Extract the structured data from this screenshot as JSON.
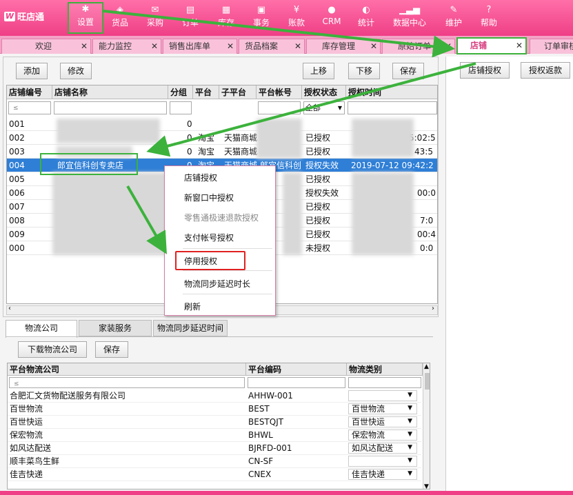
{
  "app": {
    "name": "旺店通",
    "logo_glyph": "W"
  },
  "nav": [
    {
      "label": "设置",
      "icon": "gear-icon",
      "glyph": "✱"
    },
    {
      "label": "货品",
      "icon": "box-icon",
      "glyph": "◈"
    },
    {
      "label": "采购",
      "icon": "mail-icon",
      "glyph": "✉"
    },
    {
      "label": "订单",
      "icon": "clipboard-icon",
      "glyph": "▤"
    },
    {
      "label": "库存",
      "icon": "grid-icon",
      "glyph": "▦"
    },
    {
      "label": "事务",
      "icon": "chat-icon",
      "glyph": "▣"
    },
    {
      "label": "账款",
      "icon": "yen-icon",
      "glyph": "¥"
    },
    {
      "label": "CRM",
      "icon": "user-icon",
      "glyph": "●"
    },
    {
      "label": "统计",
      "icon": "pie-icon",
      "glyph": "◐"
    },
    {
      "label": "数据中心",
      "icon": "bar-chart-icon",
      "glyph": "▁▃▅"
    },
    {
      "label": "维护",
      "icon": "wrench-icon",
      "glyph": "✎"
    },
    {
      "label": "帮助",
      "icon": "help-icon",
      "glyph": "?"
    }
  ],
  "tabs": [
    "欢迎",
    "能力监控",
    "销售出库单",
    "货品档案",
    "库存管理",
    "原始订单",
    "店铺",
    "订单审核"
  ],
  "toolbar": {
    "add": "添加",
    "edit": "修改",
    "up": "上移",
    "down": "下移",
    "save": "保存"
  },
  "grid": {
    "headers": [
      "店铺编号",
      "店铺名称",
      "分组",
      "平台",
      "子平台",
      "平台帐号",
      "授权状态",
      "授权时间"
    ],
    "filter_status": "全部",
    "rows": [
      {
        "id": "001",
        "name": "",
        "group": "0",
        "platform": "",
        "sub": "",
        "account": "",
        "status": "",
        "time": ""
      },
      {
        "id": "002",
        "name": "",
        "group": "0",
        "platform": "淘宝",
        "sub": "天猫商城",
        "account": "",
        "status": "已授权",
        "time": "5:02:5"
      },
      {
        "id": "003",
        "name": "",
        "group": "0",
        "platform": "淘宝",
        "sub": "天猫商城",
        "account": "",
        "status": "已授权",
        "time": "43:5"
      },
      {
        "id": "004",
        "name": "郎宜信科创专卖店",
        "group": "0",
        "platform": "淘宝",
        "sub": "天猫商城",
        "account": "郎宜信科创",
        "status": "授权失效",
        "time": "2019-07-12 09:42:2"
      },
      {
        "id": "005",
        "name": "",
        "group": "",
        "platform": "",
        "sub": "",
        "account": "",
        "status": "已授权",
        "time": ""
      },
      {
        "id": "006",
        "name": "",
        "group": "",
        "platform": "",
        "sub": "",
        "account": "",
        "status": "授权失效",
        "time": "00:0"
      },
      {
        "id": "007",
        "name": "",
        "group": "",
        "platform": "",
        "sub": "",
        "account": "",
        "status": "已授权",
        "time": ""
      },
      {
        "id": "008",
        "name": "",
        "group": "",
        "platform": "",
        "sub": "",
        "account": "",
        "status": "已授权",
        "time": "7:0"
      },
      {
        "id": "009",
        "name": "",
        "group": "",
        "platform": "",
        "sub": "",
        "account": "",
        "status": "已授权",
        "time": "00:4"
      },
      {
        "id": "000",
        "name": "",
        "group": "",
        "platform": "",
        "sub": "",
        "account": "",
        "status": "未授权",
        "time": "0:0"
      }
    ]
  },
  "context_menu": [
    "店铺授权",
    "新窗口中授权",
    "零售通极速退款授权",
    "支付帐号授权",
    "停用授权",
    "物流同步延迟时长",
    "刷新"
  ],
  "right_buttons": {
    "shop_auth": "店铺授权",
    "refund_auth": "授权返款"
  },
  "bottom": {
    "tabs": [
      "物流公司",
      "家装服务",
      "物流同步延迟时间"
    ],
    "download": "下载物流公司",
    "save": "保存",
    "headers": [
      "平台物流公司",
      "平台编码",
      "物流类别"
    ],
    "rows": [
      {
        "name": "合肥汇文货物配送服务有限公司",
        "code": "AHHW-001",
        "type": ""
      },
      {
        "name": "百世物流",
        "code": "BEST",
        "type": "百世物流"
      },
      {
        "name": "百世快运",
        "code": "BESTQJT",
        "type": "百世快运"
      },
      {
        "name": "保宏物流",
        "code": "BHWL",
        "type": "保宏物流"
      },
      {
        "name": "如风达配送",
        "code": "BJRFD-001",
        "type": "如风达配送"
      },
      {
        "name": "顺丰菜鸟生鲜",
        "code": "CN-SF",
        "type": ""
      },
      {
        "name": "佳吉快递",
        "code": "CNEX",
        "type": "佳吉快递"
      }
    ]
  },
  "colors": {
    "brand": "#ef3f86",
    "highlight": "#3cb23c",
    "selection": "#2f7fd7",
    "alert": "#e02020"
  }
}
